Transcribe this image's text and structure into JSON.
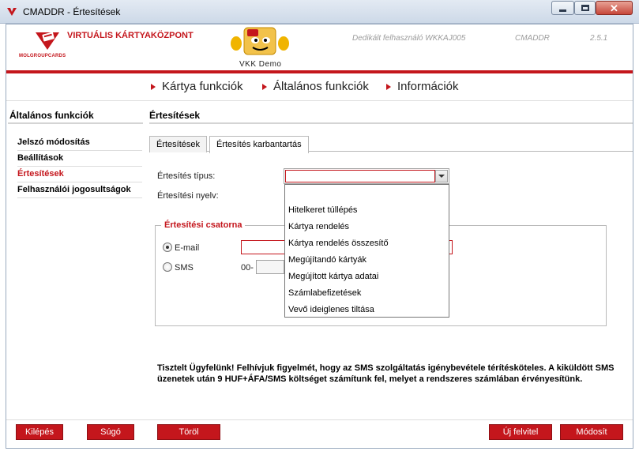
{
  "window": {
    "title": "CMADDR - Értesítések"
  },
  "header": {
    "brand": "VIRTUÁLIS KÁRTYAKÖZPONT",
    "logo_caption": "MOLGROUPCARDS",
    "mascot_caption": "VKK Demo",
    "user": "Dedikált felhasználó  WKKAJ005",
    "app_code": "CMADDR",
    "version": "2.5.1"
  },
  "topnav": [
    "Kártya funkciók",
    "Általános funkciók",
    "Információk"
  ],
  "sidebar": {
    "title": "Általános funkciók",
    "items": [
      "Jelszó módosítás",
      "Beállítások",
      "Értesítések",
      "Felhasználói jogosultságok"
    ],
    "active_index": 2
  },
  "main": {
    "title": "Értesítések",
    "tabs": [
      "Értesítések",
      "Értesítés karbantartás"
    ],
    "active_tab": 1,
    "form": {
      "type_label": "Értesítés típus:",
      "type_value": "",
      "language_label": "Értesítési nyelv:",
      "channel_legend": "Értesítési csatorna",
      "email_label": "E-mail",
      "sms_label": "SMS",
      "sms_prefix": "00-"
    },
    "dropdown_options": [
      "",
      "Hitelkeret túllépés",
      "Kártya rendelés",
      "Kártya rendelés összesítő",
      "Megújítandó kártyák",
      "Megújított kártya adatai",
      "Számlabefizetések",
      "Vevő ideiglenes tiltása"
    ],
    "notice": "Tisztelt Ügyfelünk! Felhívjuk figyelmét, hogy az SMS szolgáltatás igénybevétele térítésköteles. A kiküldött SMS üzenetek után 9 HUF+ÁFA/SMS költséget számítunk fel, melyet a rendszeres számlában érvényesítünk."
  },
  "buttons": {
    "logout": "Kilépés",
    "help": "Súgó",
    "delete": "Töröl",
    "new": "Új felvitel",
    "modify": "Módosít"
  },
  "colors": {
    "accent": "#c4161c"
  }
}
